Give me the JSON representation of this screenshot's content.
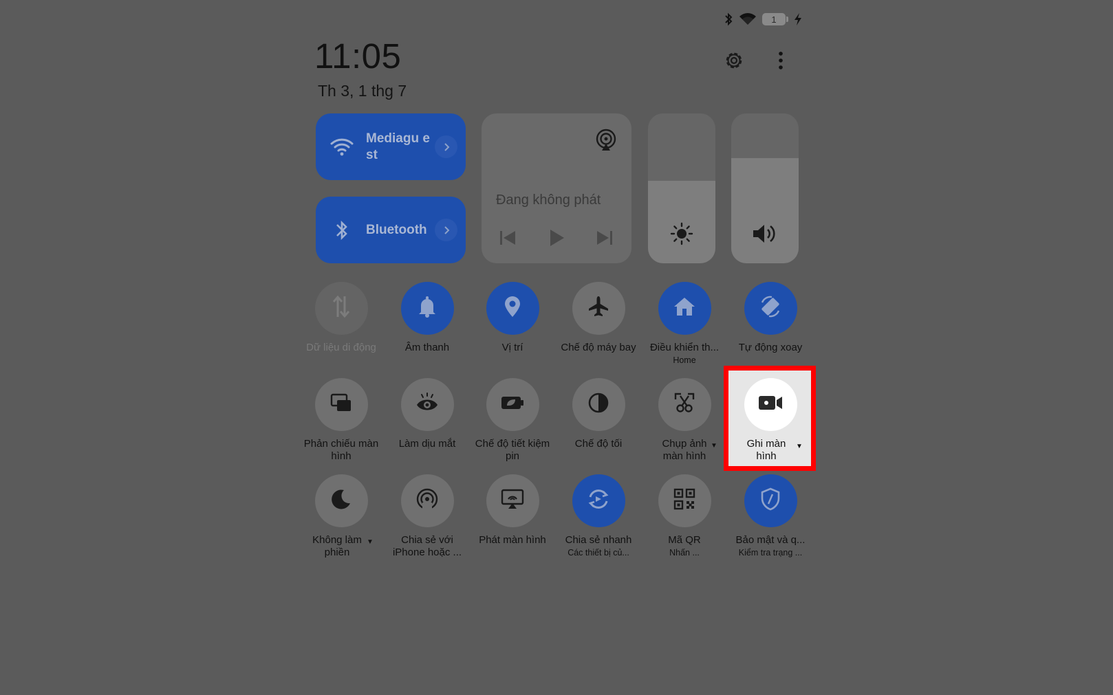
{
  "status_bar": {
    "battery_level": "1",
    "icons": [
      "bluetooth-icon",
      "wifi-icon",
      "battery-icon",
      "charging-icon"
    ]
  },
  "header": {
    "time": "11:05",
    "date": "Th 3, 1 thg 7"
  },
  "connectivity": {
    "wifi": {
      "label": "Mediaguest",
      "label_display": "Mediagu est"
    },
    "bluetooth": {
      "label": "Bluetooth"
    }
  },
  "media": {
    "status": "Đang không phát"
  },
  "sliders": {
    "brightness_level": 0.55,
    "volume_level": 0.7
  },
  "toggles": {
    "mobile_data": {
      "label": "Dữ liệu di động",
      "on": false
    },
    "sound": {
      "label": "Âm thanh",
      "on": true
    },
    "location": {
      "label": "Vị trí",
      "on": true
    },
    "airplane": {
      "label": "Chế độ máy bay",
      "on": false
    },
    "home_control": {
      "label": "Điều khiển th...",
      "sub": "Home",
      "on": true
    },
    "auto_rotate": {
      "label": "Tự động xoay",
      "on": true
    },
    "screen_mirror": {
      "label": "Phản chiếu màn hình",
      "on": false
    },
    "eye_comfort": {
      "label": "Làm dịu mắt",
      "on": false
    },
    "battery_saver": {
      "label": "Chế độ tiết kiệm pin",
      "on": false
    },
    "dark_mode": {
      "label": "Chế độ tối",
      "on": false
    },
    "screenshot": {
      "label": "Chụp ảnh màn hình",
      "on": false
    },
    "screen_record": {
      "label": "Ghi màn hình",
      "on": false
    },
    "dnd": {
      "label": "Không làm phiền",
      "on": false
    },
    "share_iphone": {
      "label": "Chia sẻ với iPhone hoặc ...",
      "on": false
    },
    "cast": {
      "label": "Phát màn hình",
      "on": false
    },
    "quick_share": {
      "label": "Chia sẻ nhanh",
      "sub": "Các thiết bị củ...",
      "on": true
    },
    "qr": {
      "label": "Mã QR",
      "sub": "Nhấn ...",
      "on": false
    },
    "security": {
      "label": "Bảo mật và q...",
      "sub": "Kiểm tra trạng ...",
      "on": true
    }
  },
  "colors": {
    "accent": "#1e4fad",
    "scrim": "#5b5b5b",
    "highlight": "#ff0000"
  }
}
